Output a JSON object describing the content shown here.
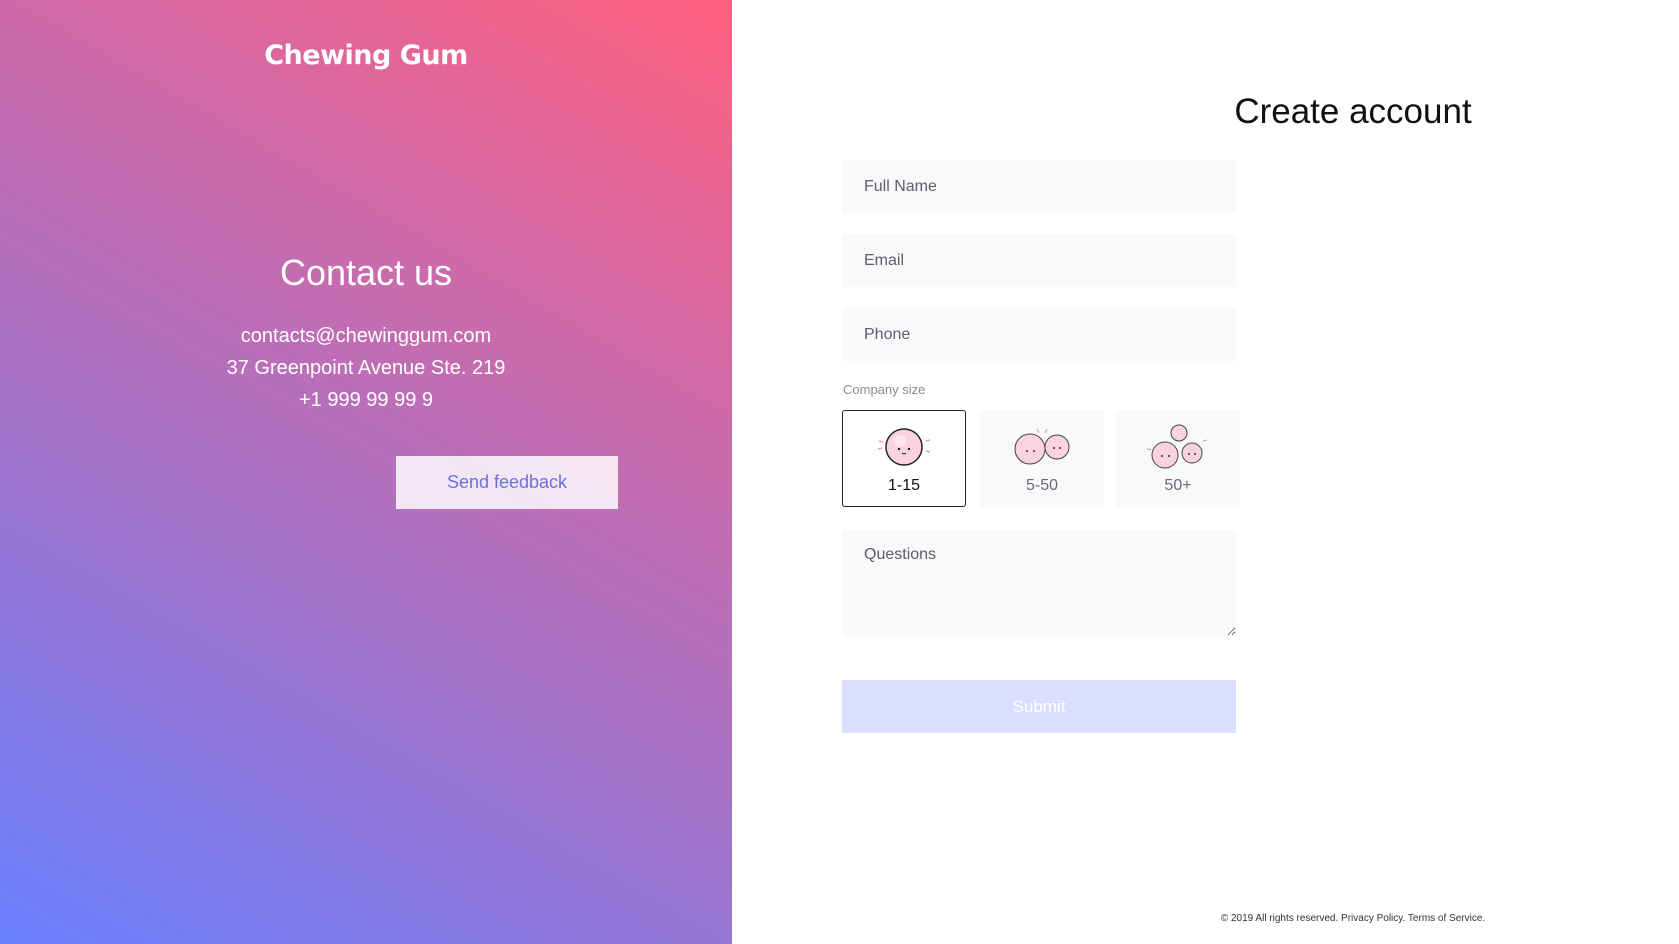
{
  "brand": {
    "logo_text": "Chewing Gum"
  },
  "contact": {
    "title": "Contact us",
    "email": "contacts@chewinggum.com",
    "address": "37 Greenpoint Avenue Ste. 219",
    "phone": "+1 999 99 99 9",
    "feedback_label": "Send feedback"
  },
  "form": {
    "title": "Create account",
    "full_name_placeholder": "Full Name",
    "email_placeholder": "Email",
    "phone_placeholder": "Phone",
    "company_size_label": "Company size",
    "company_sizes": [
      {
        "label": "1-15",
        "selected": true
      },
      {
        "label": "5-50",
        "selected": false
      },
      {
        "label": "50+",
        "selected": false
      }
    ],
    "questions_placeholder": "Questions",
    "submit_label": "Submit"
  },
  "footer": {
    "copyright": "© 2019 All rights reserved.",
    "privacy": "Privacy Policy.",
    "terms": "Terms of Service."
  },
  "colors": {
    "gradient_start": "#6a80ff",
    "gradient_end": "#ff5f7e",
    "accent": "#6b6fe4",
    "submit_bg": "#dadfff"
  }
}
